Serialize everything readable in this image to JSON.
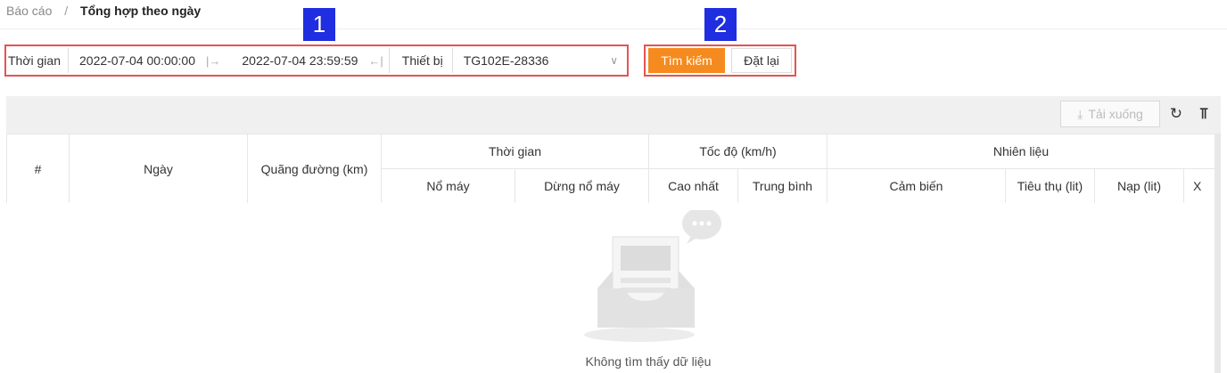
{
  "breadcrumb": {
    "root": "Báo cáo",
    "separator": "/",
    "current": "Tổng hợp theo ngày"
  },
  "filter": {
    "time_label": "Thời gian",
    "date_from": "2022-07-04 00:00:00",
    "date_to": "2022-07-04 23:59:59",
    "device_label": "Thiết bị",
    "device_value": "TG102E-28336"
  },
  "buttons": {
    "search": "Tìm kiếm",
    "reset": "Đặt lại",
    "download": "Tải xuống"
  },
  "markers": [
    "1",
    "2"
  ],
  "table": {
    "headers": {
      "index": "#",
      "date": "Ngày",
      "distance": "Quãng đường (km)",
      "time_group": "Thời gian",
      "speed_group": "Tốc độ (km/h)",
      "fuel_group": "Nhiên liệu",
      "engine_on": "Nổ máy",
      "engine_off": "Dừng nổ máy",
      "speed_max": "Cao nhất",
      "speed_avg": "Trung bình",
      "sensor": "Cảm biến",
      "consumed": "Tiêu thụ (lit)",
      "refill": "Nạp (lit)",
      "extra": "X"
    },
    "empty_text": "Không tìm thấy dữ liệu"
  },
  "colors": {
    "accent": "#f58b1f",
    "highlight": "#e55353",
    "marker": "#1f2ee0"
  }
}
